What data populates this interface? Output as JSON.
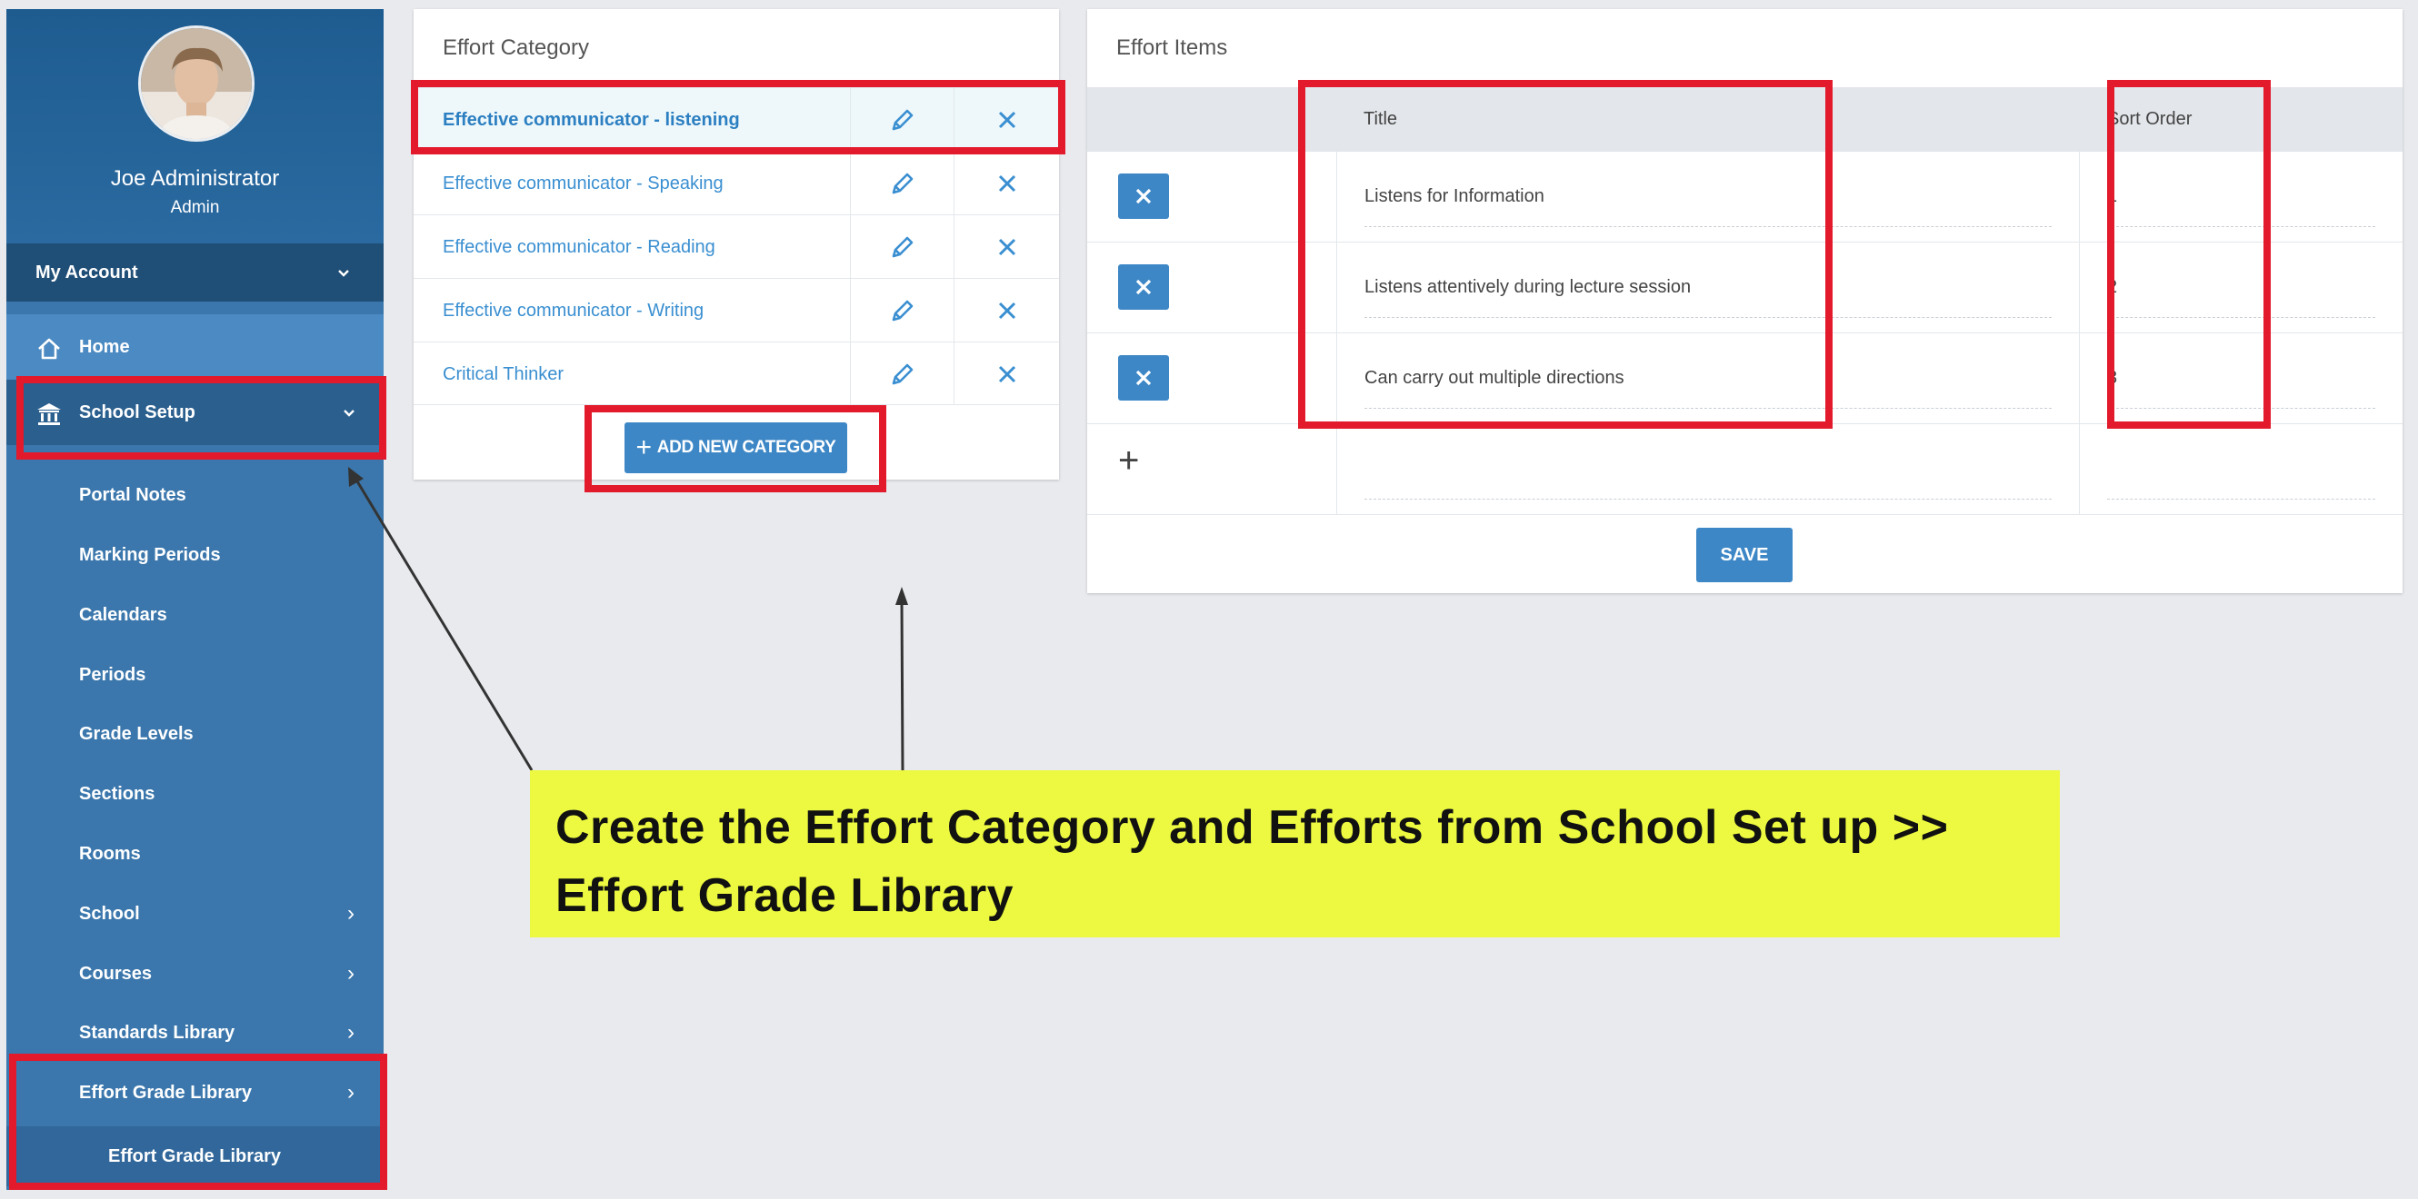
{
  "sidebar": {
    "user_name": "Joe Administrator",
    "user_role": "Admin",
    "my_account_label": "My Account",
    "home_label": "Home",
    "school_setup_label": "School Setup",
    "sub_items": [
      {
        "label": "Portal Notes",
        "chevron": ""
      },
      {
        "label": "Marking Periods",
        "chevron": ""
      },
      {
        "label": "Calendars",
        "chevron": ""
      },
      {
        "label": "Periods",
        "chevron": ""
      },
      {
        "label": "Grade Levels",
        "chevron": ""
      },
      {
        "label": "Sections",
        "chevron": ""
      },
      {
        "label": "Rooms",
        "chevron": ""
      },
      {
        "label": "School",
        "chevron": "›"
      },
      {
        "label": "Courses",
        "chevron": "›"
      },
      {
        "label": "Standards Library",
        "chevron": "›"
      },
      {
        "label": "Effort Grade Library",
        "chevron": "›"
      },
      {
        "label": "Effort Grade Library",
        "chevron": ""
      }
    ],
    "icons": {
      "home": "home-icon",
      "school_setup": "building-icon",
      "chevron": "chevron-icon"
    }
  },
  "effort_category": {
    "title": "Effort Category",
    "categories": [
      "Effective communicator - listening",
      "Effective communicator - Speaking",
      "Effective communicator - Reading",
      "Effective communicator - Writing",
      "Critical Thinker"
    ],
    "add_button_label": "ADD NEW CATEGORY"
  },
  "effort_items": {
    "title": "Effort Items",
    "columns": {
      "title": "Title",
      "sort_order": "Sort Order"
    },
    "rows": [
      {
        "title": "Listens for Information",
        "sort": "1"
      },
      {
        "title": "Listens attentively during lecture session",
        "sort": "2"
      },
      {
        "title": "Can carry out multiple directions",
        "sort": "3"
      }
    ],
    "save_label": "SAVE"
  },
  "callout": {
    "line1": "Create the Effort Category and Efforts from School Set up >>",
    "line2": "Effort Grade Library"
  },
  "colors": {
    "sidebar": "#3b77ac",
    "accent": "#3d87c6",
    "highlight": "#e21a2c",
    "callout": "#ecf940"
  }
}
